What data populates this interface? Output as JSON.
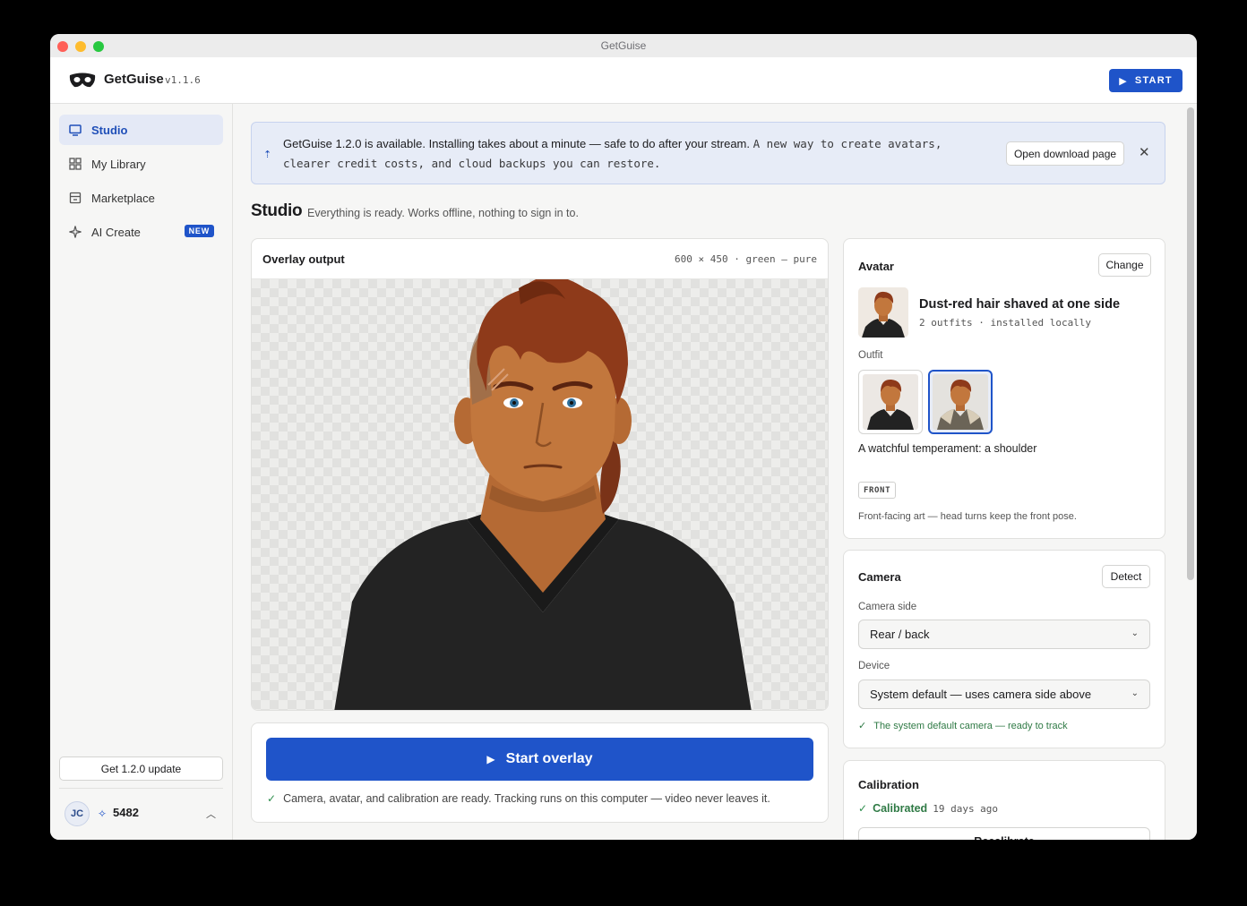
{
  "window": {
    "title": "GetGuise"
  },
  "app": {
    "name": "GetGuise",
    "version": "v1.1.6",
    "start_label": "START"
  },
  "sidebar": {
    "items": [
      {
        "label": "Studio",
        "icon": "monitor-icon",
        "active": true
      },
      {
        "label": "My Library",
        "icon": "grid-icon",
        "active": false
      },
      {
        "label": "Marketplace",
        "icon": "store-icon",
        "active": false
      },
      {
        "label": "AI Create",
        "icon": "sparkle-icon",
        "active": false,
        "badge": "NEW"
      }
    ],
    "update_button": "Get 1.2.0 update",
    "user": {
      "initials": "JC",
      "credits": "5482"
    }
  },
  "banner": {
    "message": "GetGuise 1.2.0 is available. Installing takes about a minute — safe to do after your stream.",
    "detail": "A new way to create avatars, clearer credit costs, and cloud backups you can restore.",
    "button": "Open download page"
  },
  "page": {
    "title": "Studio",
    "subtitle": "Everything is ready. Works offline, nothing to sign in to."
  },
  "overlay": {
    "title": "Overlay output",
    "meta": "600 × 450 · green — pure",
    "start_label": "Start overlay",
    "ready_note": "Camera, avatar, and calibration are ready. Tracking runs on this computer — video never leaves it."
  },
  "avatar": {
    "title": "Avatar",
    "change_label": "Change",
    "name": "Dust-red hair shaved at one side",
    "meta": "2 outfits · installed locally",
    "outfit_label": "Outfit",
    "outfit_desc": "A watchful temperament: a shoulder",
    "tag": "FRONT",
    "tag_note": "Front-facing art — head turns keep the front pose."
  },
  "camera": {
    "title": "Camera",
    "detect_label": "Detect",
    "side_label": "Camera side",
    "side_value": "Rear / back",
    "device_label": "Device",
    "device_value": "System default — uses camera side above",
    "status": "The system default camera — ready to track"
  },
  "calibration": {
    "title": "Calibration",
    "status": "Calibrated",
    "ago": "19 days ago",
    "recalibrate_label": "Recalibrate"
  },
  "colors": {
    "accent": "#1f54c9",
    "success": "#2f7a45",
    "banner_bg": "#e7ecf7"
  }
}
